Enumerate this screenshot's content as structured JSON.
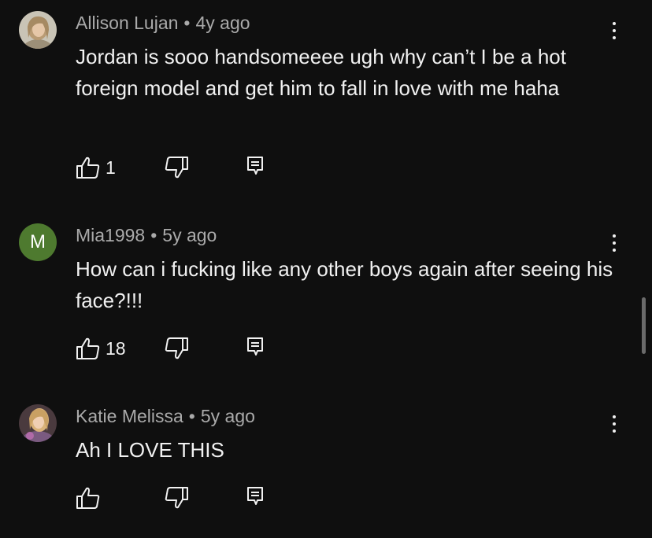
{
  "comments": [
    {
      "author": "Allison Lujan",
      "separator": "•",
      "time": "4y ago",
      "text": "Jordan is sooo handsomeeee ugh why can’t I be a hot foreign model and get him to fall in love with me haha",
      "likes": "1",
      "avatar_type": "photo",
      "avatar_color": "#b8a88e"
    },
    {
      "author": "Mia1998",
      "separator": "•",
      "time": "5y ago",
      "text": "How can i fucking like any other boys again after seeing his face?!!!",
      "likes": "18",
      "avatar_type": "letter",
      "avatar_letter": "M",
      "avatar_color": "#4e7a2f"
    },
    {
      "author": "Katie Melissa",
      "separator": "•",
      "time": "5y ago",
      "text": "Ah I LOVE THIS",
      "likes": "",
      "avatar_type": "photo",
      "avatar_color": "#8a5a6e"
    }
  ],
  "icons": {
    "like": "thumbs-up-icon",
    "dislike": "thumbs-down-icon",
    "reply": "reply-comment-icon",
    "more": "more-vertical-icon"
  },
  "colors": {
    "background": "#0f0f0f",
    "text": "#f1f1f1",
    "meta": "#aaaaaa"
  }
}
